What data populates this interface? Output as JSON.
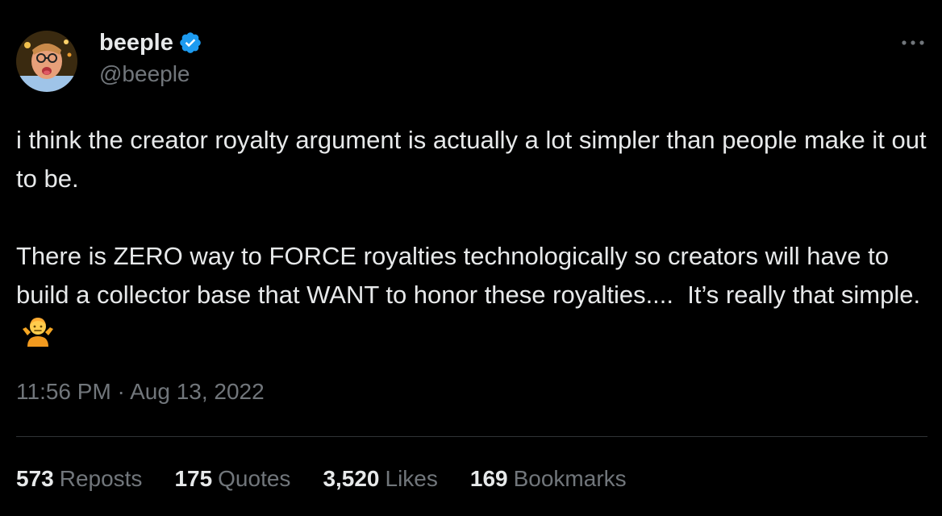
{
  "author": {
    "display_name": "beeple",
    "handle": "@beeple",
    "verified": true,
    "avatar_icon": "profile-photo"
  },
  "tweet": {
    "paragraph_1": "i think the creator royalty argument is actually a lot simpler than people make it out to be.",
    "paragraph_2": "There is ZERO way to FORCE royalties technologically so creators will have to build a collector base that WANT to honor these royalties....  It’s really that simple.",
    "emoji": "shrugging-person-emoji",
    "timestamp": "11:56 PM · Aug 13, 2022"
  },
  "stats": [
    {
      "count": "573",
      "label": "Reposts"
    },
    {
      "count": "175",
      "label": "Quotes"
    },
    {
      "count": "3,520",
      "label": "Likes"
    },
    {
      "count": "169",
      "label": "Bookmarks"
    }
  ],
  "colors": {
    "background": "#000000",
    "primary_text": "#e7e9ea",
    "secondary_text": "#71767b",
    "verified_blue": "#1d9bf0",
    "divider": "#2f3336"
  }
}
